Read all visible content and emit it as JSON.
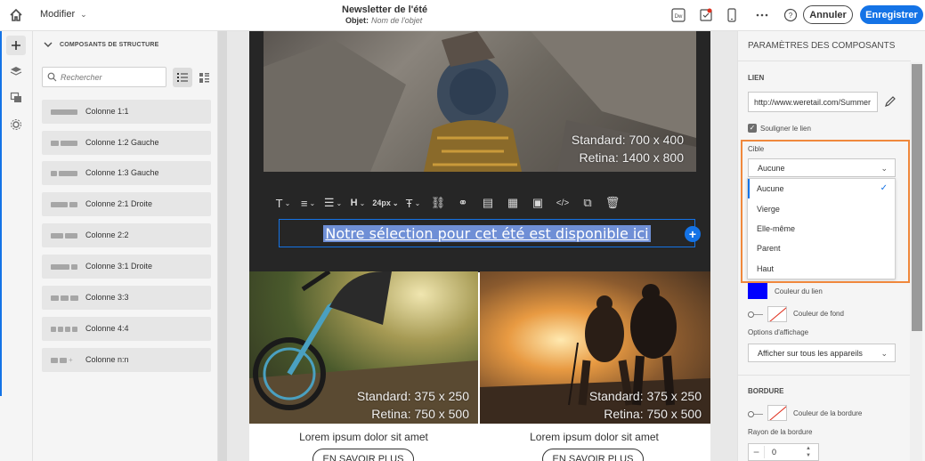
{
  "header": {
    "mode_label": "Modifier",
    "title": "Newsletter de l'été",
    "subject_label": "Objet:",
    "subject_placeholder": "Nom de l'objet",
    "cancel_label": "Annuler",
    "save_label": "Enregistrer",
    "accent_color": "#1473e6"
  },
  "components_panel": {
    "section_title": "COMPOSANTS DE STRUCTURE",
    "search_placeholder": "Rechercher",
    "items": [
      {
        "label": "Colonne 1:1"
      },
      {
        "label": "Colonne 1:2 Gauche"
      },
      {
        "label": "Colonne 1:3 Gauche"
      },
      {
        "label": "Colonne 2:1 Droite"
      },
      {
        "label": "Colonne 2:2"
      },
      {
        "label": "Colonne 3:1 Droite"
      },
      {
        "label": "Colonne 3:3"
      },
      {
        "label": "Colonne 4:4"
      },
      {
        "label": "Colonne n:n"
      }
    ]
  },
  "canvas": {
    "hero_caption_1": "Standard: 700 x 400",
    "hero_caption_2": "Retina: 1400 x 800",
    "toolbar_font_size": "24px",
    "headline": "Notre sélection pour cet été est disponible ici",
    "col_caption_1": "Standard: 375 x 250",
    "col_caption_2": "Retina: 750 x 500",
    "col_text": "Lorem ipsum dolor sit amet",
    "col_button": "EN SAVOIR PLUS"
  },
  "properties": {
    "title": "PARAMÈTRES DES COMPOSANTS",
    "link_section": "LIEN",
    "link_value": "http://www.weretail.com/Summer",
    "underline_label": "Souligner le lien",
    "target_label": "Cible",
    "target_selected": "Aucune",
    "target_options": [
      "Aucune",
      "Vierge",
      "Elle-même",
      "Parent",
      "Haut"
    ],
    "link_color_label": "Couleur du lien",
    "link_color": "#0000ff",
    "bg_color_label": "Couleur de fond",
    "display_options_label": "Options d'affichage",
    "display_selected": "Afficher sur tous les appareils",
    "border_section": "BORDURE",
    "border_color_label": "Couleur de la bordure",
    "border_radius_label": "Rayon de la bordure",
    "border_radius_value": "0"
  }
}
